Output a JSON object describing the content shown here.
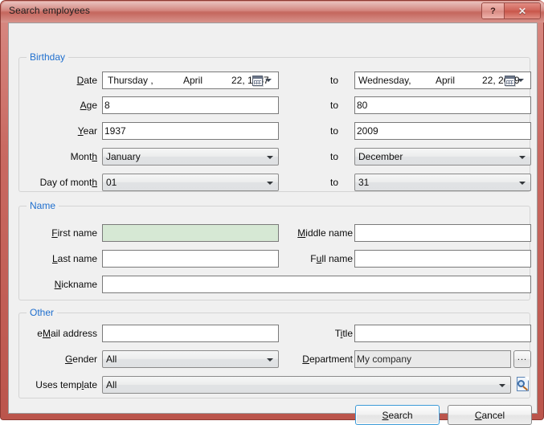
{
  "window": {
    "title": "Search employees",
    "help_button": "?",
    "close_button": "✕",
    "accent_red": "#c4675e",
    "group_label_color": "#1f6fce",
    "focus_field_color": "#d6e8d4"
  },
  "groups": {
    "birthday": {
      "title": "Birthday"
    },
    "name": {
      "title": "Name"
    },
    "other": {
      "title": "Other"
    }
  },
  "birthday": {
    "rows": [
      {
        "label_pre": "",
        "label_accel": "D",
        "label_post": "ate",
        "from_type": "datepicker",
        "from_value_day": "Thursday ,",
        "from_value_month": "April",
        "from_value_date": "22, 1937",
        "to_label": "to",
        "to_value_day": "Wednesday,",
        "to_value_month": "April",
        "to_value_date": "22, 2009"
      },
      {
        "label_pre": "",
        "label_accel": "A",
        "label_post": "ge",
        "from_type": "text",
        "from_value": "8",
        "to_label": "to",
        "to_value": "80"
      },
      {
        "label_pre": "",
        "label_accel": "Y",
        "label_post": "ear",
        "from_type": "text",
        "from_value": "1937",
        "to_label": "to",
        "to_value": "2009"
      },
      {
        "label_pre": "Mont",
        "label_accel": "h",
        "label_post": "",
        "from_type": "combo",
        "from_value": "January",
        "to_label": "to",
        "to_value": "December"
      },
      {
        "label_pre": "Day of mont",
        "label_accel": "h",
        "label_post": "",
        "from_type": "combo",
        "from_value": "01",
        "to_label": "to",
        "to_value": "31"
      }
    ]
  },
  "name": {
    "first_name": {
      "label_pre": "",
      "label_accel": "F",
      "label_post": "irst name",
      "value": ""
    },
    "middle_name": {
      "label_pre": "",
      "label_accel": "M",
      "label_post": "iddle name",
      "value": ""
    },
    "last_name": {
      "label_pre": "",
      "label_accel": "L",
      "label_post": "ast name",
      "value": ""
    },
    "full_name": {
      "label_pre": "F",
      "label_accel": "u",
      "label_post": "ll name",
      "value": ""
    },
    "nickname": {
      "label_pre": "",
      "label_accel": "N",
      "label_post": "ickname",
      "value": ""
    }
  },
  "other": {
    "email": {
      "label_pre": "e",
      "label_accel": "M",
      "label_post": "ail address",
      "value": ""
    },
    "title": {
      "label_pre": "T",
      "label_accel": "i",
      "label_post": "tle",
      "value": ""
    },
    "gender": {
      "label_pre": "",
      "label_accel": "G",
      "label_post": "ender",
      "value": "All"
    },
    "department": {
      "label_pre": "",
      "label_accel": "D",
      "label_post": "epartment",
      "value": "My company",
      "browse_button": "..."
    },
    "uses_template": {
      "label_pre": "Uses temp",
      "label_accel": "l",
      "label_post": "ate",
      "value": "All"
    }
  },
  "footer": {
    "search": {
      "pre": "",
      "accel": "S",
      "post": "earch"
    },
    "cancel": {
      "pre": "",
      "accel": "C",
      "post": "ancel"
    }
  }
}
